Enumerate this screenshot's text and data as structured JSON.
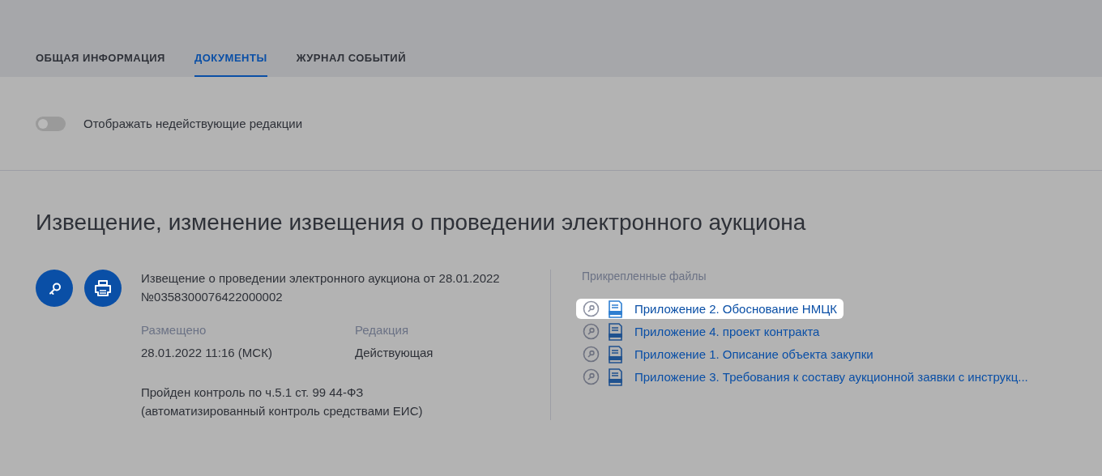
{
  "tabs": [
    {
      "label": "ОБЩАЯ ИНФОРМАЦИЯ",
      "selected": false
    },
    {
      "label": "ДОКУМЕНТЫ",
      "selected": true
    },
    {
      "label": "ЖУРНАЛ СОБЫТИЙ",
      "selected": false
    }
  ],
  "toggle": {
    "label": "Отображать недействующие редакции",
    "on": false
  },
  "section": {
    "title": "Извещение, изменение извещения о проведении электронного аукциона",
    "document": {
      "title": "Извещение о проведении электронного аукциона от 28.01.2022 №0358300076422000002",
      "fields": [
        {
          "label": "Размещено",
          "value": "28.01.2022 11:16 (МСК)"
        },
        {
          "label": "Редакция",
          "value": "Действующая"
        }
      ],
      "note": "Пройден контроль по ч.5.1 ст. 99 44-ФЗ (автоматизированный контроль средствами ЕИС)"
    },
    "files_title": "Прикрепленные файлы",
    "files": [
      {
        "name": "Приложение 2. Обоснование НМЦК",
        "highlighted": true
      },
      {
        "name": "Приложение 4. проект контракта",
        "highlighted": false
      },
      {
        "name": "Приложение 1. Описание объекта закупки",
        "highlighted": false
      },
      {
        "name": "Приложение 3. Требования к составу аукционной заявки с инструкц...",
        "highlighted": false
      }
    ]
  }
}
